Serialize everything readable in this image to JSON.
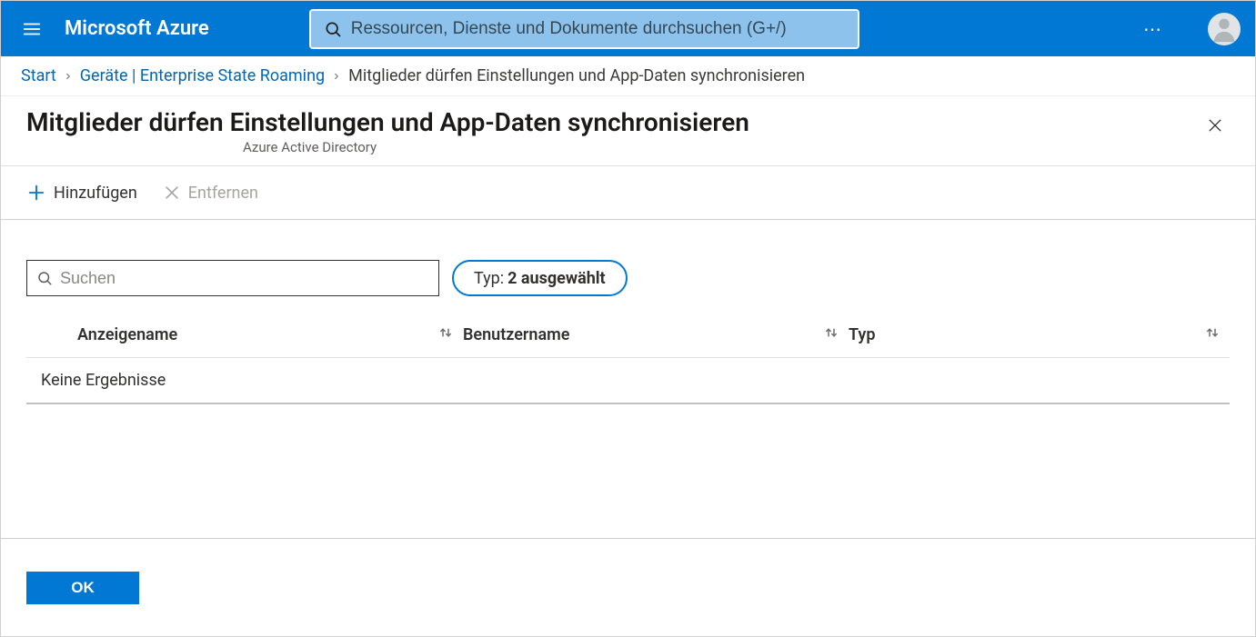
{
  "brand": "Microsoft Azure",
  "global_search": {
    "placeholder": "Ressourcen, Dienste und Dokumente durchsuchen (G+/)"
  },
  "breadcrumb": {
    "items": [
      {
        "label": "Start"
      },
      {
        "label": "Geräte | Enterprise State Roaming"
      }
    ],
    "current": "Mitglieder dürfen Einstellungen und App-Daten synchronisieren"
  },
  "page": {
    "title": "Mitglieder dürfen Einstellungen und App-Daten synchronisieren",
    "subtitle": "Azure Active Directory"
  },
  "commands": {
    "add": "Hinzufügen",
    "remove": "Entfernen"
  },
  "filters": {
    "search_placeholder": "Suchen",
    "type_label": "Typ:",
    "type_value": "2 ausgewählt"
  },
  "columns": {
    "display_name": "Anzeigename",
    "user_name": "Benutzername",
    "type": "Typ"
  },
  "results": {
    "empty": "Keine Ergebnisse"
  },
  "footer": {
    "ok": "OK"
  }
}
